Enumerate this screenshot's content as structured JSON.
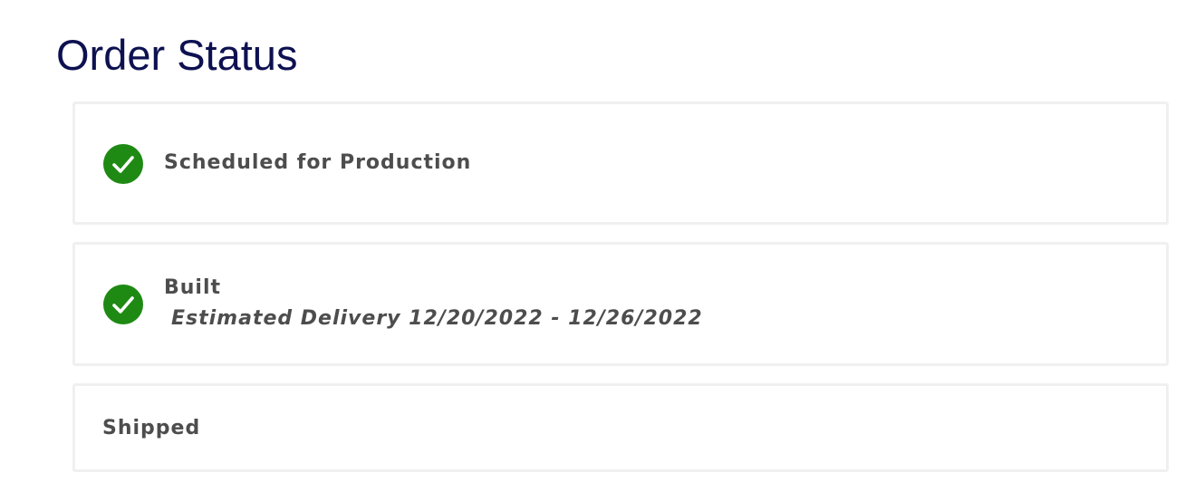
{
  "page": {
    "title": "Order Status"
  },
  "colors": {
    "title": "#0e1150",
    "check": "#1e8a14",
    "text": "#4d4d4d",
    "card_border": "#f0f0f0"
  },
  "steps": [
    {
      "label": "Scheduled for Production",
      "completed": true,
      "icon": "check-circle-icon"
    },
    {
      "label": "Built",
      "subtext": "Estimated Delivery 12/20/2022 - 12/26/2022",
      "completed": true,
      "icon": "check-circle-icon"
    },
    {
      "label": "Shipped",
      "completed": false
    }
  ]
}
